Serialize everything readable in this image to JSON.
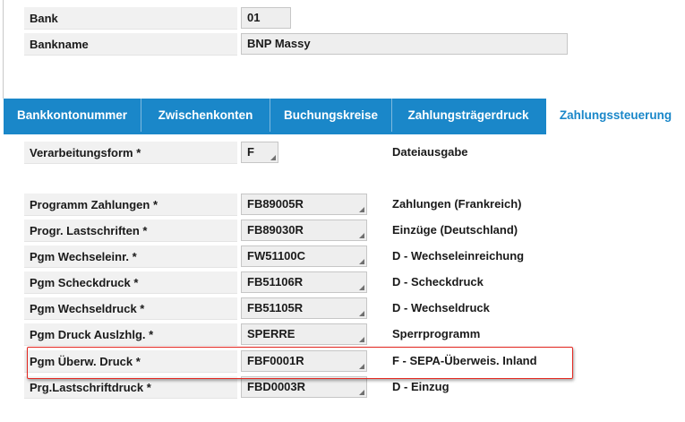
{
  "header": {
    "bank_label": "Bank",
    "bank_value": "01",
    "bankname_label": "Bankname",
    "bankname_value": "BNP Massy"
  },
  "tabs": [
    {
      "label": "Bankkontonummer",
      "active": false
    },
    {
      "label": "Zwischenkonten",
      "active": false
    },
    {
      "label": "Buchungskreise",
      "active": false
    },
    {
      "label": "Zahlungsträgerdruck",
      "active": false
    },
    {
      "label": "Zahlungssteuerung",
      "active": true
    }
  ],
  "colors": {
    "tab_bar": "#1a87c9",
    "highlight_border": "#e3261f"
  },
  "form": {
    "verarbeitungsform": {
      "label": "Verarbeitungsform *",
      "value": "F",
      "description": "Dateiausgabe"
    },
    "rows": [
      {
        "label": "Programm Zahlungen *",
        "value": "FB89005R",
        "description": "Zahlungen (Frankreich)"
      },
      {
        "label": "Progr. Lastschriften *",
        "value": "FB89030R",
        "description": "Einzüge (Deutschland)"
      },
      {
        "label": "Pgm Wechseleinr. *",
        "value": "FW51100C",
        "description": "D - Wechseleinreichung"
      },
      {
        "label": "Pgm Scheckdruck *",
        "value": "FB51106R",
        "description": "D - Scheckdruck"
      },
      {
        "label": "Pgm Wechseldruck *",
        "value": "FB51105R",
        "description": "D - Wechseldruck"
      },
      {
        "label": "Pgm Druck Auslzhlg. *",
        "value": "SPERRE",
        "description": "Sperrprogramm"
      },
      {
        "label": "Pgm Überw. Druck *",
        "value": "FBF0001R",
        "description": "F - SEPA-Überweis. Inland"
      },
      {
        "label": "Prg.Lastschriftdruck *",
        "value": "FBD0003R",
        "description": "D - Einzug"
      }
    ]
  }
}
